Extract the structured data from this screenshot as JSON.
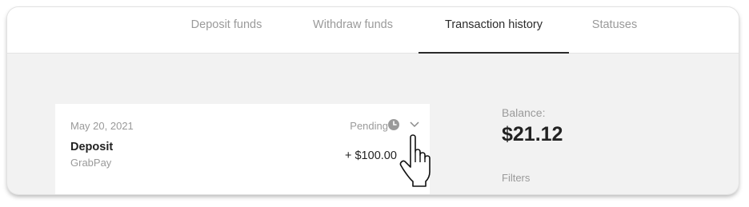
{
  "tabs": [
    {
      "label": "Deposit funds",
      "active": false
    },
    {
      "label": "Withdraw funds",
      "active": false
    },
    {
      "label": "Transaction history",
      "active": true
    },
    {
      "label": "Statuses",
      "active": false
    }
  ],
  "transaction": {
    "date": "May 20, 2021",
    "status": "Pending",
    "status_icon": "clock-icon",
    "expand_icon": "chevron-down-icon",
    "type": "Deposit",
    "method": "GrabPay",
    "amount": "+ $100.00"
  },
  "balance": {
    "label": "Balance:",
    "value": "$21.12"
  },
  "filters": {
    "label": "Filters"
  },
  "colors": {
    "active_tab_text": "#2b2b2b",
    "inactive_text": "#9a9a9a",
    "page_background": "#f2f2f2",
    "card_background": "#ffffff"
  }
}
